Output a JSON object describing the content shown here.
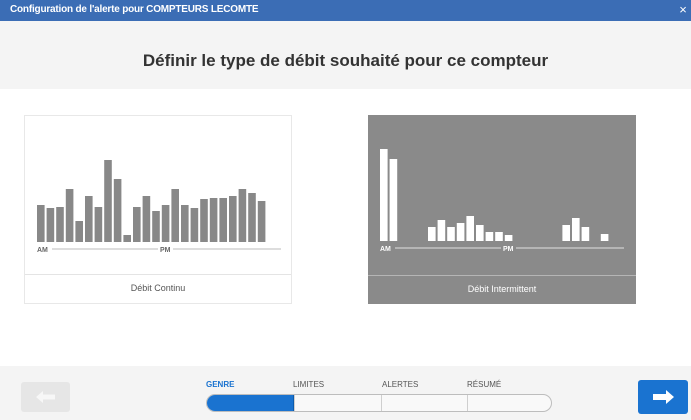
{
  "window": {
    "title": "Configuration de l'alerte pour COMPTEURS LECOMTE",
    "close_glyph": "×",
    "title_bar_color": "#3b6db5"
  },
  "header": {
    "heading": "Définir le type de débit souhaité pour ce compteur"
  },
  "options": [
    {
      "label": "Débit Continu",
      "selected": false,
      "chart_data": {
        "type": "bar",
        "xlabels": [
          "AM",
          "PM"
        ],
        "values": [
          37,
          34,
          35,
          53,
          21,
          46,
          35,
          82,
          63,
          7,
          35,
          46,
          31,
          37,
          53,
          37,
          34,
          43,
          44,
          44,
          46,
          53,
          49,
          41
        ],
        "color": "#888888"
      }
    },
    {
      "label": "Débit Intermittent",
      "selected": true,
      "chart_data": {
        "type": "bar",
        "xlabels": [
          "AM",
          "PM"
        ],
        "values": [
          92,
          82,
          0,
          0,
          0,
          14,
          21,
          14,
          18,
          25,
          16,
          9,
          9,
          6,
          0,
          0,
          0,
          0,
          0,
          16,
          23,
          14,
          0,
          7
        ],
        "color": "#ffffff",
        "background": "#8a8a8a"
      }
    }
  ],
  "footer": {
    "prev_icon": "arrow-left-icon",
    "next_icon": "arrow-right-icon",
    "accent": "#1a73d0",
    "steps": [
      {
        "label": "GENRE",
        "active": true
      },
      {
        "label": "LIMITES",
        "active": false
      },
      {
        "label": "ALERTES",
        "active": false
      },
      {
        "label": "RÉSUMÉ",
        "active": false
      }
    ],
    "progress_fraction": 0.25
  }
}
